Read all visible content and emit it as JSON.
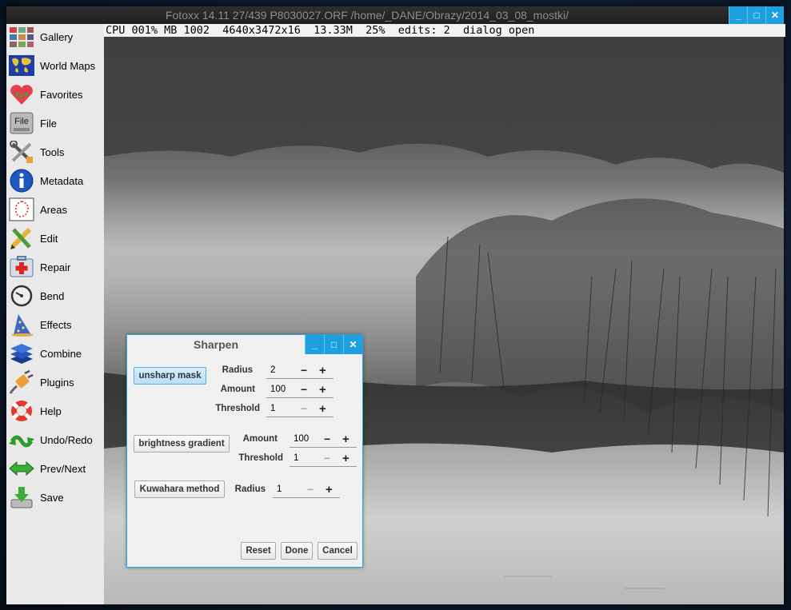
{
  "window": {
    "title": "Fotoxx 14.11  27/439  P8030027.ORF  /home/_DANE/Obrazy/2014_03_08_mostki/",
    "status": "CPU 001% MB 1002  4640x3472x16  13.33M  25%  edits: 2  dialog open",
    "controls": {
      "minimize": "_",
      "maximize": "□",
      "close": "✕"
    }
  },
  "sidebar": {
    "items": [
      {
        "label": "Gallery",
        "icon": "gallery-icon"
      },
      {
        "label": "World Maps",
        "icon": "world-map-icon"
      },
      {
        "label": "Favorites",
        "icon": "heart-icon"
      },
      {
        "label": "File",
        "icon": "file-icon"
      },
      {
        "label": "Tools",
        "icon": "tools-icon"
      },
      {
        "label": "Metadata",
        "icon": "info-icon"
      },
      {
        "label": "Areas",
        "icon": "area-select-icon"
      },
      {
        "label": "Edit",
        "icon": "edit-pencil-icon"
      },
      {
        "label": "Repair",
        "icon": "first-aid-icon"
      },
      {
        "label": "Bend",
        "icon": "gauge-icon"
      },
      {
        "label": "Effects",
        "icon": "wizard-hat-icon"
      },
      {
        "label": "Combine",
        "icon": "layers-icon"
      },
      {
        "label": "Plugins",
        "icon": "plug-icon"
      },
      {
        "label": "Help",
        "icon": "lifebuoy-icon"
      },
      {
        "label": "Undo/Redo",
        "icon": "undo-redo-icon"
      },
      {
        "label": "Prev/Next",
        "icon": "prev-next-icon"
      },
      {
        "label": "Save",
        "icon": "save-icon"
      }
    ],
    "file_icon_text": "File"
  },
  "dialog": {
    "title": "Sharpen",
    "unsharp": {
      "button": "unsharp mask",
      "radius_label": "Radius",
      "radius": "2",
      "amount_label": "Amount",
      "amount": "100",
      "threshold_label": "Threshold",
      "threshold": "1"
    },
    "brightness": {
      "button": "brightness gradient",
      "amount_label": "Amount",
      "amount": "100",
      "threshold_label": "Threshold",
      "threshold": "1"
    },
    "kuwahara": {
      "button": "Kuwahara method",
      "radius_label": "Radius",
      "radius": "1"
    },
    "buttons": {
      "reset": "Reset",
      "done": "Done",
      "cancel": "Cancel"
    },
    "minus": "−",
    "plus": "+"
  }
}
